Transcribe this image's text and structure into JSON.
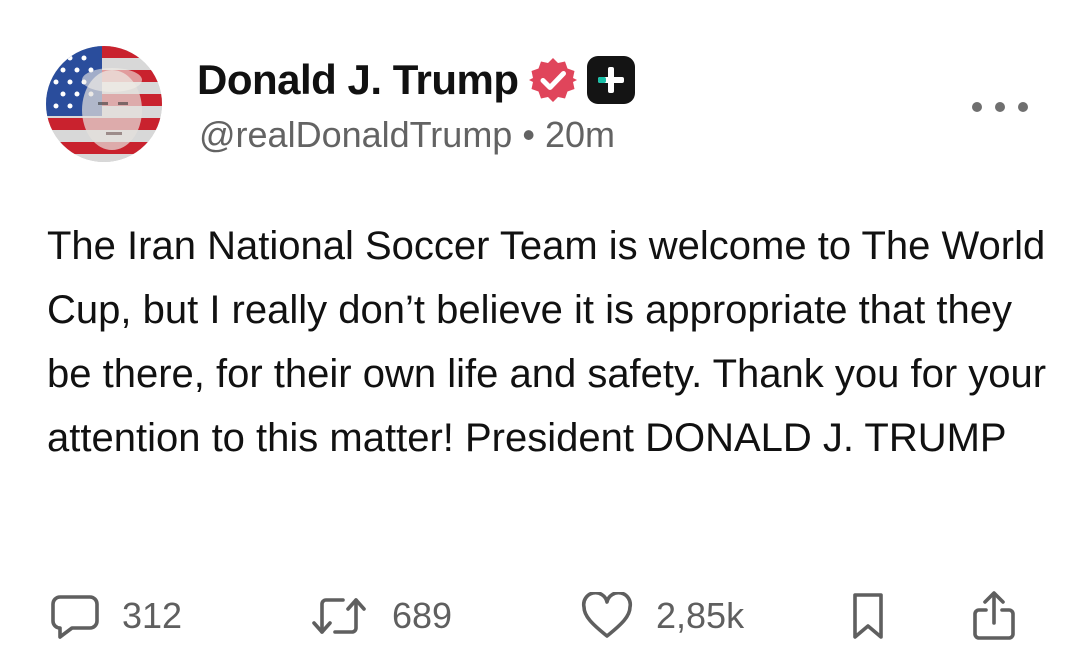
{
  "author": {
    "display_name": "Donald J. Trump",
    "handle": "@realDonaldTrump",
    "separator": "•",
    "timestamp": "20m",
    "avatar_icon": "flag-portrait-avatar",
    "verified_icon": "verified-badge-icon",
    "subscriber_icon": "plus-badge-icon"
  },
  "post": {
    "text": "The Iran National Soccer Team is welcome to The World Cup, but I really don’t believe it is appropriate that they be there, for their own life and safety. Thank you for your attention to this matter! President DONALD J. TRUMP"
  },
  "actions": {
    "replies": "312",
    "reposts": "689",
    "likes": "2,85k"
  },
  "colors": {
    "verified": "#e0455b",
    "text": "#111111",
    "muted": "#636363",
    "badge_bg": "#141414",
    "badge_accent": "#18c0a8"
  }
}
